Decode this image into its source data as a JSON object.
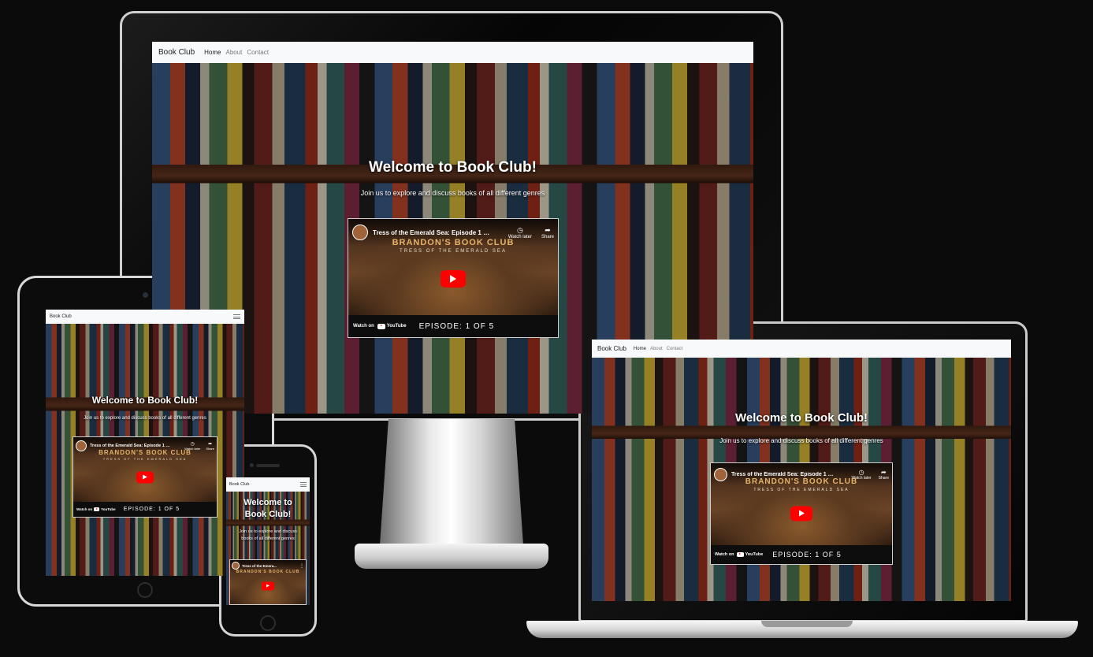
{
  "site": {
    "brand": "Book Club",
    "nav": {
      "home": "Home",
      "about": "About",
      "contact": "Contact"
    },
    "hero": {
      "title": "Welcome to Book Club!",
      "subtitle": "Join us to explore and discuss books of all different genres"
    },
    "video": {
      "title": "Tress of the Emerald Sea: Episode 1 of...",
      "title_short": "Tress of the Emera...",
      "watch_later": "Watch later",
      "share": "Share",
      "channel_line": "BRANDON'S BOOK CLUB",
      "sub_line": "TRESS OF THE EMERALD SEA",
      "watch_on": "Watch on",
      "youtube": "YouTube",
      "episode": "EPISODE: 1 OF 5"
    }
  },
  "phone": {
    "hero_title_line1": "Welcome to",
    "hero_title_line2": "Book Club!",
    "hero_sub_line1": "Join us to explore and discuss",
    "hero_sub_line2": "books of all different genres"
  },
  "icons": {
    "menu": "hamburger-menu-icon",
    "play": "play-icon",
    "clock": "watch-later-icon",
    "share": "share-icon"
  },
  "colors": {
    "navbar": "#f8f9fa",
    "youtube_red": "#ff0000",
    "backdrop": "#0b0b0b"
  }
}
